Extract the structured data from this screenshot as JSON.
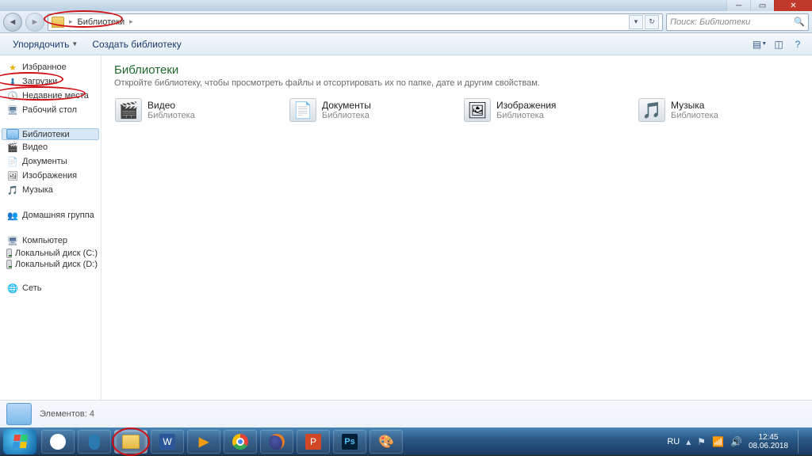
{
  "window": {
    "breadcrumb": "Библиотеки",
    "search_placeholder": "Поиск: Библиотеки"
  },
  "toolbar": {
    "organize": "Упорядочить",
    "new_library": "Создать библиотеку"
  },
  "nav": {
    "favorites": "Избранное",
    "downloads": "Загрузки",
    "recent": "Недавние места",
    "desktop": "Рабочий стол",
    "libraries": "Библиотеки",
    "video": "Видео",
    "documents": "Документы",
    "pictures": "Изображения",
    "music": "Музыка",
    "homegroup": "Домашняя группа",
    "computer": "Компьютер",
    "disk_c": "Локальный диск (C:)",
    "disk_d": "Локальный диск (D:)",
    "network": "Сеть"
  },
  "content": {
    "title": "Библиотеки",
    "subtitle": "Откройте библиотеку, чтобы просмотреть файлы и отсортировать их по папке, дате и другим свойствам.",
    "items": [
      {
        "name": "Видео",
        "sub": "Библиотека",
        "emblem": "🎬"
      },
      {
        "name": "Документы",
        "sub": "Библиотека",
        "emblem": "📄"
      },
      {
        "name": "Изображения",
        "sub": "Библиотека",
        "emblem": "🖼"
      },
      {
        "name": "Музыка",
        "sub": "Библиотека",
        "emblem": "🎵"
      }
    ]
  },
  "status": {
    "elements": "Элементов: 4"
  },
  "tray": {
    "lang": "RU",
    "time": "12:45",
    "date": "08.06.2018"
  }
}
